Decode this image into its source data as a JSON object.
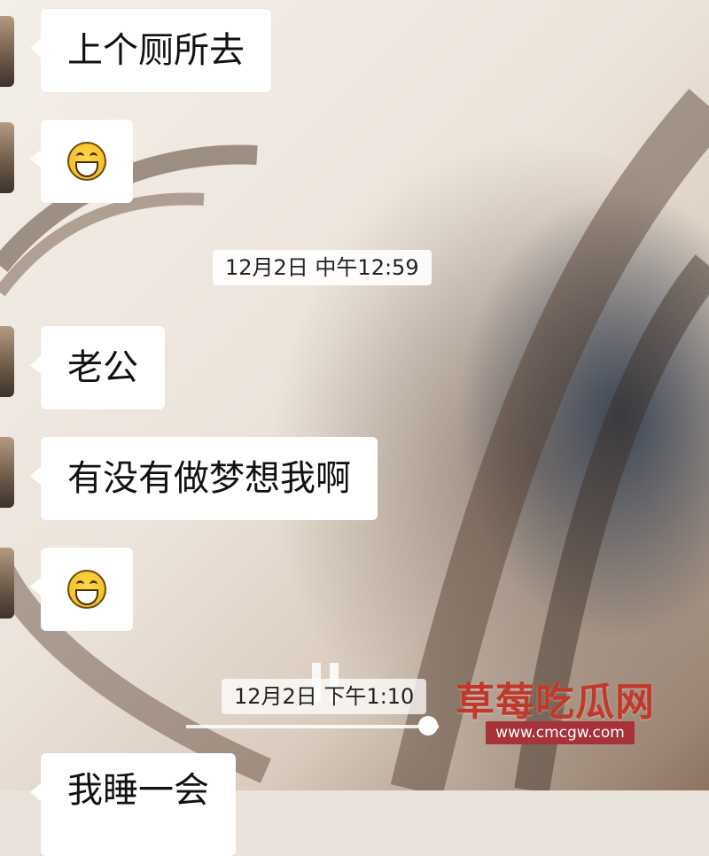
{
  "messages": [
    {
      "type": "text",
      "text": "上个厕所去"
    },
    {
      "type": "emoji",
      "emoji": "grinning-face-icon"
    },
    {
      "type": "timestamp",
      "text": "12月2日 中午12:59"
    },
    {
      "type": "text",
      "text": "老公"
    },
    {
      "type": "text",
      "text": "有没有做梦想我啊"
    },
    {
      "type": "emoji",
      "emoji": "grinning-face-icon"
    },
    {
      "type": "timestamp",
      "text": "12月2日 下午1:10"
    },
    {
      "type": "text",
      "text": "我睡一会"
    }
  ],
  "watermark": {
    "title": "草莓吃瓜网",
    "url": "www.cmcgw.com",
    "title_color": "#c0392b",
    "url_bg": "#a8323a"
  },
  "colors": {
    "bubble": "#ffffff",
    "timestamp_bg": "#ffffff",
    "emoji": "#f2b31c"
  }
}
